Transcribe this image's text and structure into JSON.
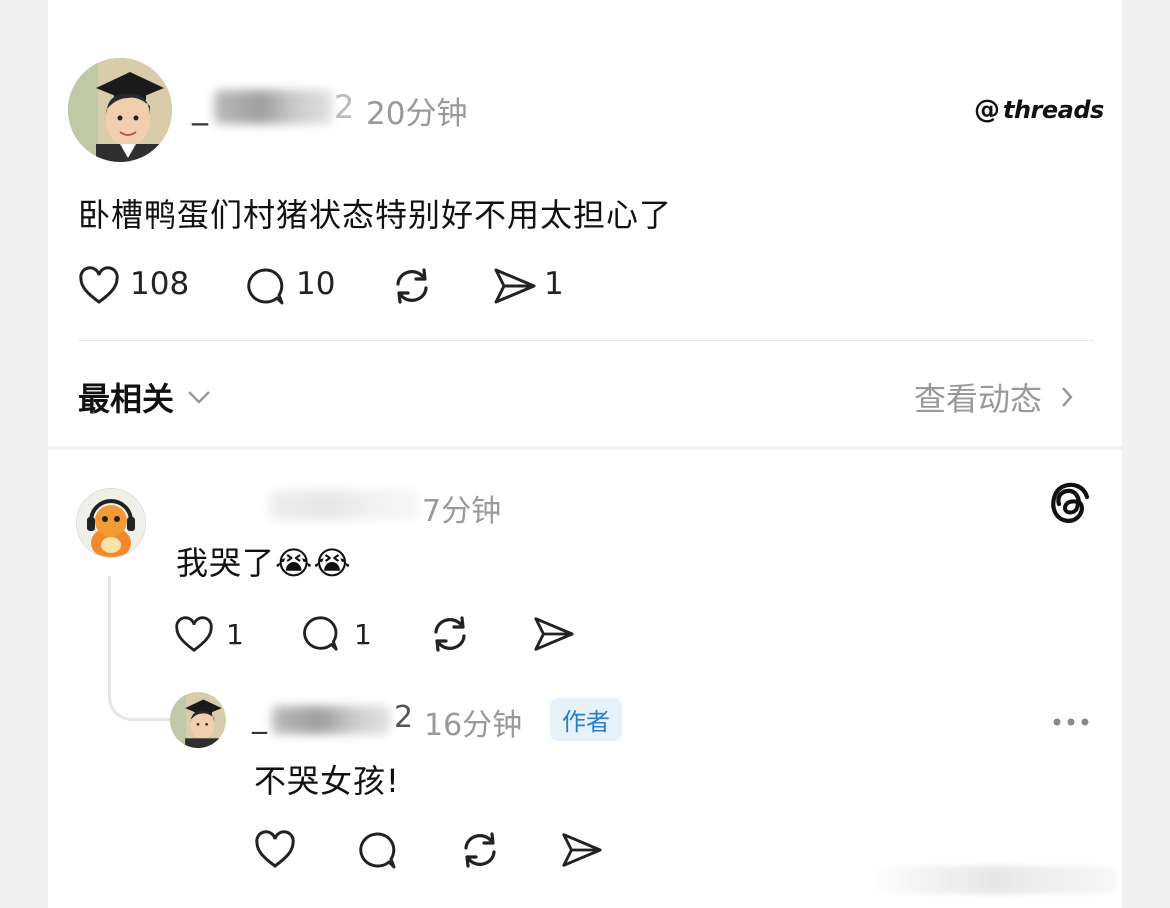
{
  "post": {
    "username_visible": "_",
    "username_suffix": "2",
    "time": "20分钟",
    "text": "卧槽鸭蛋们村猪状态特别好不用太担心了",
    "likes": "108",
    "replies": "10",
    "shares": "1"
  },
  "brand": {
    "logo_text": "threads"
  },
  "sort": {
    "label": "最相关",
    "view_activity": "查看动态"
  },
  "comment": {
    "time": "7分钟",
    "text": "我哭了😭😭",
    "likes": "1",
    "replies": "1"
  },
  "reply": {
    "username_visible": "_",
    "username_suffix": "2",
    "time": "16分钟",
    "badge": "作者",
    "text": "不哭女孩!"
  },
  "colors": {
    "badge_bg": "#e7f1fa",
    "badge_text": "#2a7fc6",
    "muted": "#999999"
  }
}
